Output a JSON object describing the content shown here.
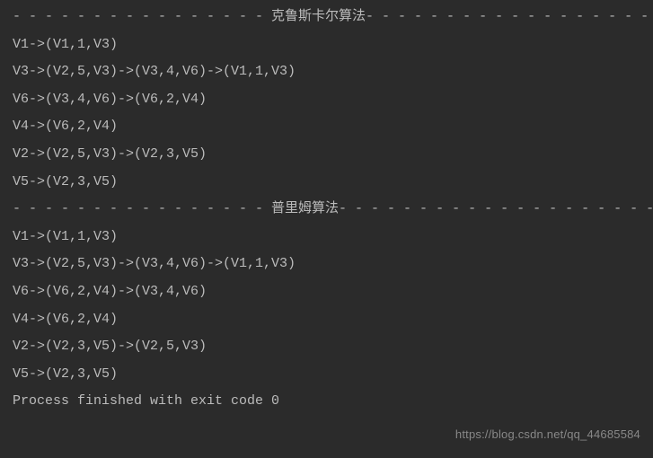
{
  "lines": [
    "- - - - - - - - - - - - - - - - 克鲁斯卡尔算法- - - - - - - - - - - - - - - - - - - - - - - - -",
    "V1->(V1,1,V3)",
    "V3->(V2,5,V3)->(V3,4,V6)->(V1,1,V3)",
    "V6->(V3,4,V6)->(V6,2,V4)",
    "V4->(V6,2,V4)",
    "V2->(V2,5,V3)->(V2,3,V5)",
    "V5->(V2,3,V5)",
    "- - - - - - - - - - - - - - - - 普里姆算法- - - - - - - - - - - - - - - - - - - - - - - - -",
    "V1->(V1,1,V3)",
    "V3->(V2,5,V3)->(V3,4,V6)->(V1,1,V3)",
    "V6->(V6,2,V4)->(V3,4,V6)",
    "V4->(V6,2,V4)",
    "V2->(V2,3,V5)->(V2,5,V3)",
    "V5->(V2,3,V5)",
    "",
    "Process finished with exit code 0"
  ],
  "watermark": "https://blog.csdn.net/qq_44685584"
}
